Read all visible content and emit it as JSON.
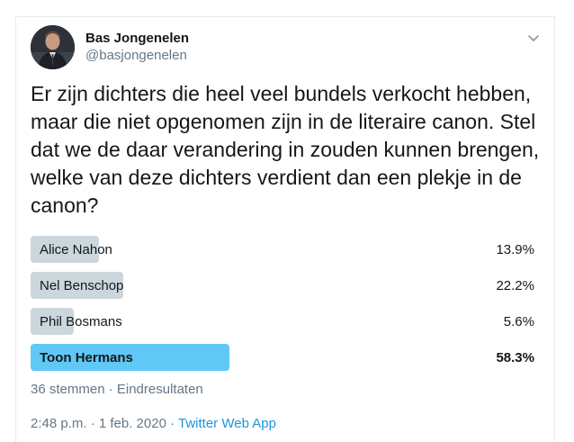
{
  "author": {
    "name": "Bas Jongenelen",
    "handle": "@basjongenelen"
  },
  "tweet": {
    "text": "Er zijn dichters die heel veel bundels verkocht hebben, maar die niet opgenomen zijn in de literaire canon. Stel dat we de daar verandering in zouden kunnen brengen, welke van deze dichters verdient dan een plekje in de canon?"
  },
  "poll": {
    "options": [
      {
        "label": "Alice Nahon",
        "percent_text": "13.9%",
        "percent": 13.9,
        "winner": false
      },
      {
        "label": "Nel Benschop",
        "percent_text": "22.2%",
        "percent": 22.2,
        "winner": false
      },
      {
        "label": "Phil Bosmans",
        "percent_text": "5.6%",
        "percent": 5.6,
        "winner": false
      },
      {
        "label": "Toon Hermans",
        "percent_text": "58.3%",
        "percent": 58.3,
        "winner": true
      }
    ],
    "meta": "36 stemmen · Eindresultaten"
  },
  "footer": {
    "time": "2:48 p.m. · 1 feb. 2020 · ",
    "source": "Twitter Web App"
  },
  "colors": {
    "bar": "#ccd6dd",
    "winner_bar": "#5fc8f5",
    "link": "#1b95e0",
    "secondary_text": "#657786"
  },
  "icons": {
    "menu": "chevron-down-icon"
  }
}
